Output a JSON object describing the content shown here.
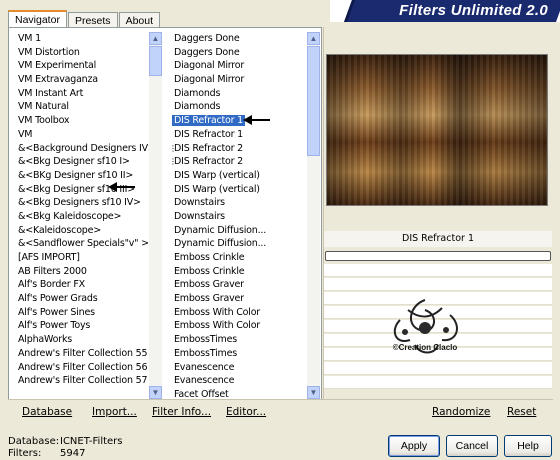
{
  "banner": {
    "title": "Filters Unlimited 2.0"
  },
  "tabs": [
    "Navigator",
    "Presets",
    "About"
  ],
  "left_list": [
    "VM 1",
    "VM Distortion",
    "VM Experimental",
    "VM Extravaganza",
    "VM Instant Art",
    "VM Natural",
    "VM Toolbox",
    "VM",
    "&<Background Designers IV>",
    "&<Bkg Designer sf10 I>",
    "&<BKg Designer sf10 II>",
    "&<Bkg Designer sf10 III>",
    "&<Bkg Designers sf10 IV>",
    "&<Bkg Kaleidoscope>",
    "&<Kaleidoscope>",
    "&<Sandflower Specials\"v\" >",
    "[AFS IMPORT]",
    "AB Filters 2000",
    "Alf's Border FX",
    "Alf's Power Grads",
    "Alf's Power Sines",
    "Alf's Power Toys",
    "AlphaWorks",
    "Andrew's Filter Collection 55",
    "Andrew's Filter Collection 56",
    "Andrew's Filter Collection 57"
  ],
  "right_list": [
    "Daggers Done",
    "Daggers Done",
    "Diagonal Mirror",
    "Diagonal Mirror",
    "Diamonds",
    "Diamonds",
    "DIS Refractor 1",
    "DIS Refractor 1",
    "DIS Refractor 2",
    "DIS Refractor 2",
    "DIS Warp (vertical)",
    "DIS Warp (vertical)",
    "Downstairs",
    "Downstairs",
    "Dynamic Diffusion...",
    "Dynamic Diffusion...",
    "Emboss Crinkle",
    "Emboss Crinkle",
    "Emboss Graver",
    "Emboss Graver",
    "Emboss With Color",
    "Emboss With Color",
    "EmbossTimes",
    "EmbossTimes",
    "Evanescence",
    "Evanescence",
    "Facet Offset"
  ],
  "selected_filter": "DIS Refractor 1",
  "filter_name_display": "DIS Refractor 1",
  "bottom_links": {
    "database": "Database",
    "import": "Import...",
    "filter_info": "Filter Info...",
    "editor": "Editor...",
    "randomize": "Randomize",
    "reset": "Reset"
  },
  "status": {
    "database_label": "Database:",
    "database_value": "ICNET-Filters",
    "filters_label": "Filters:",
    "filters_value": "5947"
  },
  "buttons": {
    "apply": "Apply",
    "cancel": "Cancel",
    "help": "Help"
  },
  "watermark": "©Creation Claclo",
  "colors": {
    "selection": "#316ac5",
    "banner": "#1a2a6e",
    "tab_accent": "#e68b2c"
  }
}
